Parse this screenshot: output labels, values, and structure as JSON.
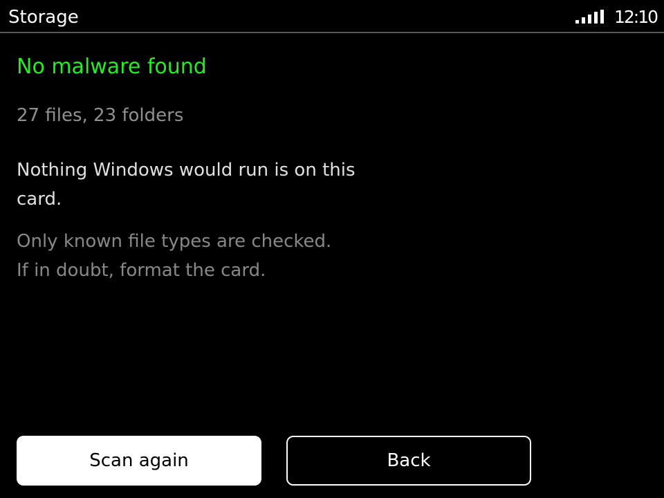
{
  "status_bar": {
    "title": "Storage",
    "time": "12:10",
    "signal_icon": "signal-strength-icon"
  },
  "result": {
    "heading": "No malware found",
    "counts": "27 files, 23 folders",
    "message": "Nothing Windows would run is on this card.",
    "note_line1": "Only known file types are checked.",
    "note_line2": "If in doubt, format the card."
  },
  "actions": {
    "scan_again_label": "Scan again",
    "back_label": "Back"
  },
  "colors": {
    "background": "#000000",
    "success": "#22ee22",
    "divider": "#5a5a5a"
  }
}
